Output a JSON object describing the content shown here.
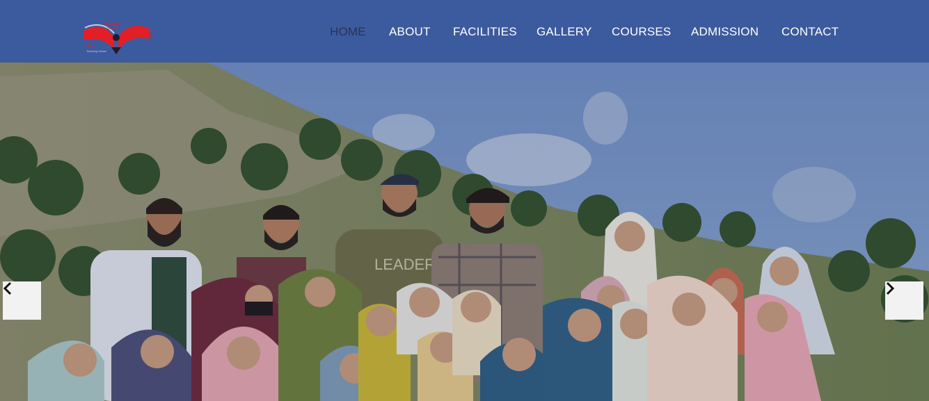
{
  "brand": {
    "logo_icon": "book-logo-icon",
    "logo_lines": [
      "Pillar Public",
      "School",
      "Shine",
      "Teaching Values"
    ],
    "colors": {
      "navbar": "#3c5a9e",
      "logo_red": "#e21f26",
      "active_nav": "#2b3350"
    }
  },
  "nav": {
    "items": [
      {
        "label": "HOME",
        "active": true
      },
      {
        "label": "ABOUT",
        "active": false
      },
      {
        "label": "FACILITIES",
        "active": false
      },
      {
        "label": "GALLERY",
        "active": false
      },
      {
        "label": "COURSES",
        "active": false
      },
      {
        "label": "ADMISSION",
        "active": false
      },
      {
        "label": "CONTACT",
        "active": false
      }
    ]
  },
  "carousel": {
    "prev_icon": "chevron-left-icon",
    "next_icon": "chevron-right-icon",
    "slide_description_icon": "group-photo-image",
    "shirt_text": "LEADER"
  }
}
